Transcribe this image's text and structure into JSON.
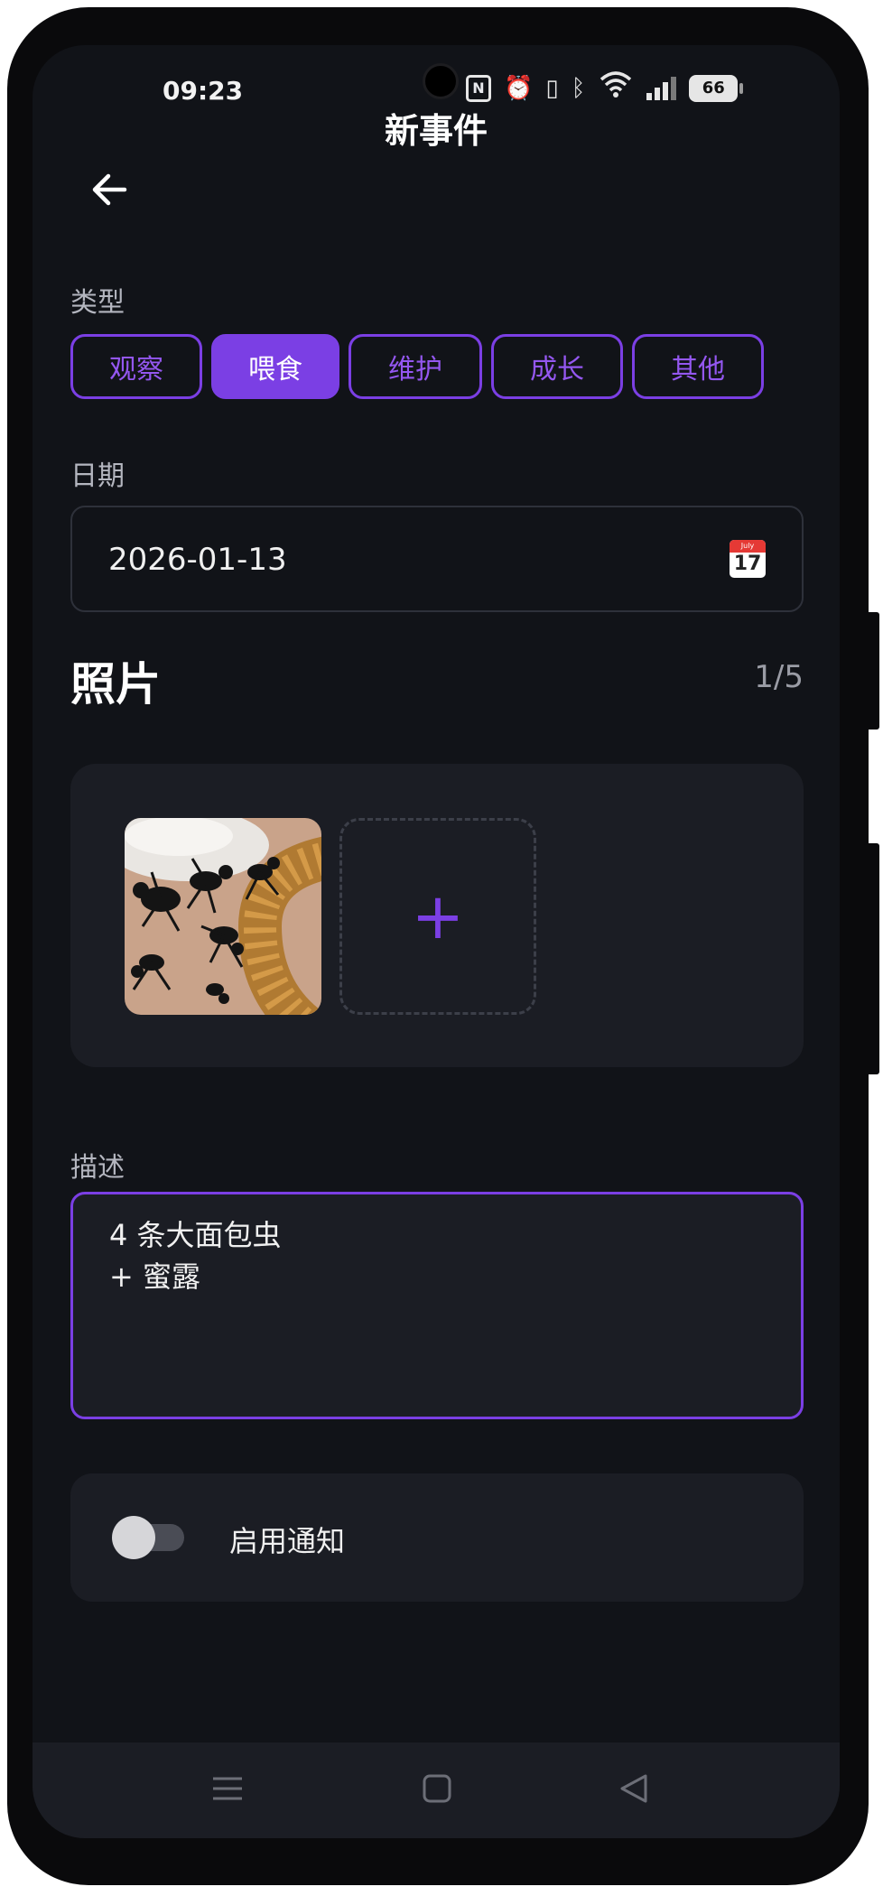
{
  "status_bar": {
    "time": "09:23",
    "nfc_label": "N",
    "battery": "66"
  },
  "app_bar": {
    "title": "新事件"
  },
  "type_section": {
    "label": "类型",
    "options": [
      "观察",
      "喂食",
      "维护",
      "成长",
      "其他"
    ],
    "selected": "喂食"
  },
  "date_section": {
    "label": "日期",
    "value": "2026-01-13",
    "calendar_month": "July",
    "calendar_day": "17"
  },
  "photos_section": {
    "title": "照片",
    "count": "1/5",
    "add_symbol": "+"
  },
  "description_section": {
    "label": "描述",
    "lines": [
      "4 条大面包虫",
      "+ 蜜露"
    ]
  },
  "notification": {
    "label": "启用通知",
    "enabled": false
  },
  "colors": {
    "background": "#111318",
    "card": "#1b1d24",
    "accent": "#7b3fe4"
  }
}
